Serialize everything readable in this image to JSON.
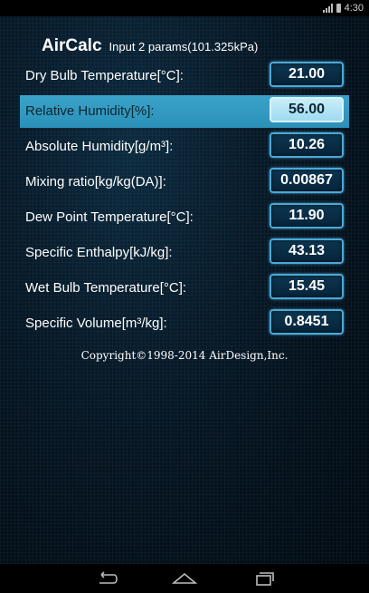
{
  "status_bar": {
    "time": "4:30"
  },
  "header": {
    "title": "AirCalc",
    "subtitle": "Input 2 params(101.325kPa)"
  },
  "rows": [
    {
      "label": "Dry Bulb Temperature[°C]:",
      "value": "21.00"
    },
    {
      "label": "Relative Humidity[%]:",
      "value": "56.00"
    },
    {
      "label": "Absolute Humidity[g/m³]:",
      "value": "10.26"
    },
    {
      "label": "Mixing ratio[kg/kg(DA)]:",
      "value": "0.00867"
    },
    {
      "label": "Dew Point Temperature[°C]:",
      "value": "11.90"
    },
    {
      "label": "Specific Enthalpy[kJ/kg]:",
      "value": "43.13"
    },
    {
      "label": "Wet Bulb Temperature[°C]:",
      "value": "15.45"
    },
    {
      "label": "Specific Volume[m³/kg]:",
      "value": "0.8451"
    }
  ],
  "copyright": "Copyright©1998-2014 AirDesign,Inc.",
  "nav": {
    "back_icon": "back-icon",
    "home_icon": "home-icon",
    "recents_icon": "recents-icon"
  },
  "colors": {
    "accent": "#4aa9d8",
    "selected_row": "#3aa3c9",
    "background": "#071826"
  }
}
